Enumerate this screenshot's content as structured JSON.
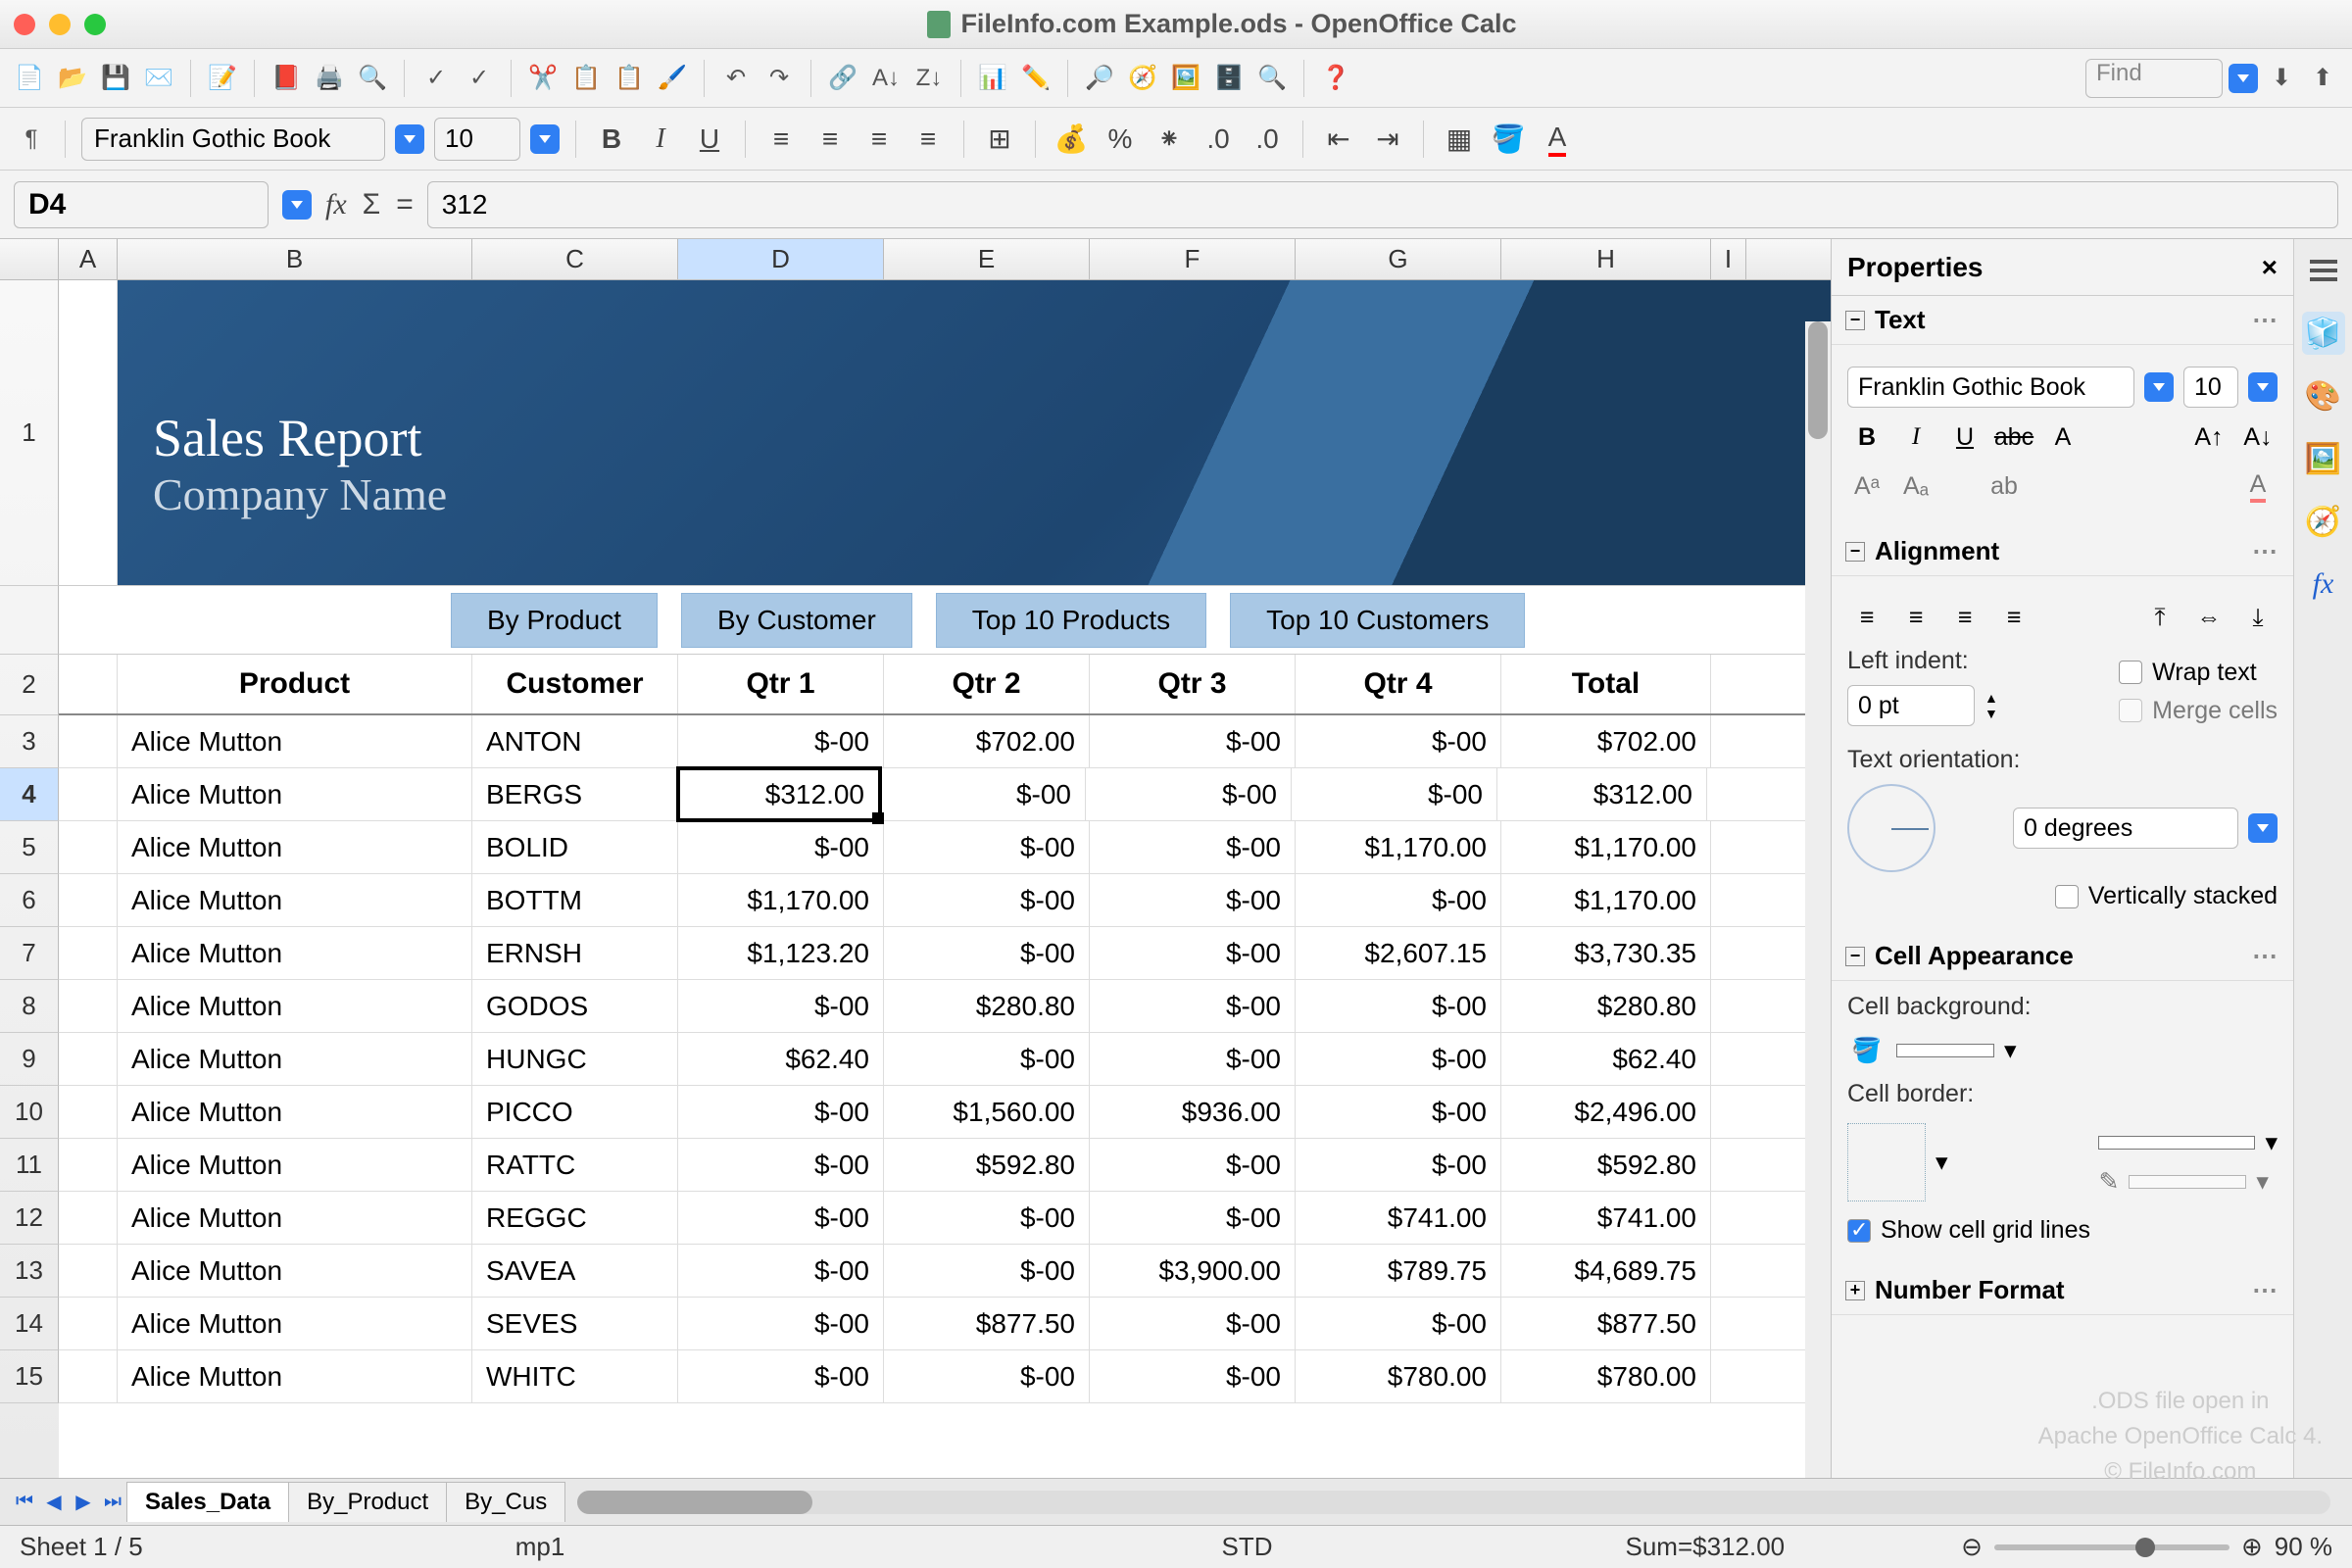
{
  "titlebar": {
    "title": "FileInfo.com Example.ods - OpenOffice Calc"
  },
  "find": {
    "placeholder": "Find"
  },
  "format": {
    "font_name": "Franklin Gothic Book",
    "font_size": "10"
  },
  "formula": {
    "cell_ref": "D4",
    "value": "312"
  },
  "columns": [
    "A",
    "B",
    "C",
    "D",
    "E",
    "F",
    "G",
    "H",
    "I"
  ],
  "banner": {
    "title": "Sales Report",
    "subtitle": "Company Name"
  },
  "banner_tabs": [
    "By Product",
    "By Customer",
    "Top 10 Products",
    "Top 10 Customers"
  ],
  "headers": {
    "product": "Product",
    "customer": "Customer",
    "q1": "Qtr 1",
    "q2": "Qtr 2",
    "q3": "Qtr 3",
    "q4": "Qtr 4",
    "total": "Total"
  },
  "rows": [
    {
      "n": 3,
      "product": "Alice Mutton",
      "customer": "ANTON",
      "q1": "$-00",
      "q2": "$702.00",
      "q3": "$-00",
      "q4": "$-00",
      "total": "$702.00"
    },
    {
      "n": 4,
      "product": "Alice Mutton",
      "customer": "BERGS",
      "q1": "$312.00",
      "q2": "$-00",
      "q3": "$-00",
      "q4": "$-00",
      "total": "$312.00"
    },
    {
      "n": 5,
      "product": "Alice Mutton",
      "customer": "BOLID",
      "q1": "$-00",
      "q2": "$-00",
      "q3": "$-00",
      "q4": "$1,170.00",
      "total": "$1,170.00"
    },
    {
      "n": 6,
      "product": "Alice Mutton",
      "customer": "BOTTM",
      "q1": "$1,170.00",
      "q2": "$-00",
      "q3": "$-00",
      "q4": "$-00",
      "total": "$1,170.00"
    },
    {
      "n": 7,
      "product": "Alice Mutton",
      "customer": "ERNSH",
      "q1": "$1,123.20",
      "q2": "$-00",
      "q3": "$-00",
      "q4": "$2,607.15",
      "total": "$3,730.35"
    },
    {
      "n": 8,
      "product": "Alice Mutton",
      "customer": "GODOS",
      "q1": "$-00",
      "q2": "$280.80",
      "q3": "$-00",
      "q4": "$-00",
      "total": "$280.80"
    },
    {
      "n": 9,
      "product": "Alice Mutton",
      "customer": "HUNGC",
      "q1": "$62.40",
      "q2": "$-00",
      "q3": "$-00",
      "q4": "$-00",
      "total": "$62.40"
    },
    {
      "n": 10,
      "product": "Alice Mutton",
      "customer": "PICCO",
      "q1": "$-00",
      "q2": "$1,560.00",
      "q3": "$936.00",
      "q4": "$-00",
      "total": "$2,496.00"
    },
    {
      "n": 11,
      "product": "Alice Mutton",
      "customer": "RATTC",
      "q1": "$-00",
      "q2": "$592.80",
      "q3": "$-00",
      "q4": "$-00",
      "total": "$592.80"
    },
    {
      "n": 12,
      "product": "Alice Mutton",
      "customer": "REGGC",
      "q1": "$-00",
      "q2": "$-00",
      "q3": "$-00",
      "q4": "$741.00",
      "total": "$741.00"
    },
    {
      "n": 13,
      "product": "Alice Mutton",
      "customer": "SAVEA",
      "q1": "$-00",
      "q2": "$-00",
      "q3": "$3,900.00",
      "q4": "$789.75",
      "total": "$4,689.75"
    },
    {
      "n": 14,
      "product": "Alice Mutton",
      "customer": "SEVES",
      "q1": "$-00",
      "q2": "$877.50",
      "q3": "$-00",
      "q4": "$-00",
      "total": "$877.50"
    },
    {
      "n": 15,
      "product": "Alice Mutton",
      "customer": "WHITC",
      "q1": "$-00",
      "q2": "$-00",
      "q3": "$-00",
      "q4": "$780.00",
      "total": "$780.00"
    }
  ],
  "sheet_tabs": [
    "Sales_Data",
    "By_Product",
    "By_Cus"
  ],
  "status": {
    "sheet": "Sheet 1 / 5",
    "mid": "mp1",
    "mode": "STD",
    "sum": "Sum=$312.00",
    "zoom": "90 %"
  },
  "sidebar": {
    "title": "Properties",
    "text_section": "Text",
    "font_name": "Franklin Gothic Book",
    "font_size": "10",
    "align_section": "Alignment",
    "left_indent_label": "Left indent:",
    "left_indent_value": "0 pt",
    "wrap_text": "Wrap text",
    "merge_cells": "Merge cells",
    "orientation_label": "Text orientation:",
    "orientation_value": "0 degrees",
    "vert_stacked": "Vertically stacked",
    "appearance_section": "Cell Appearance",
    "bg_label": "Cell background:",
    "border_label": "Cell border:",
    "gridlines": "Show cell grid lines",
    "number_section": "Number Format"
  },
  "watermark": {
    "l1": ".ODS file open in",
    "l2": "Apache OpenOffice Calc 4.",
    "l3": "© FileInfo.com"
  }
}
